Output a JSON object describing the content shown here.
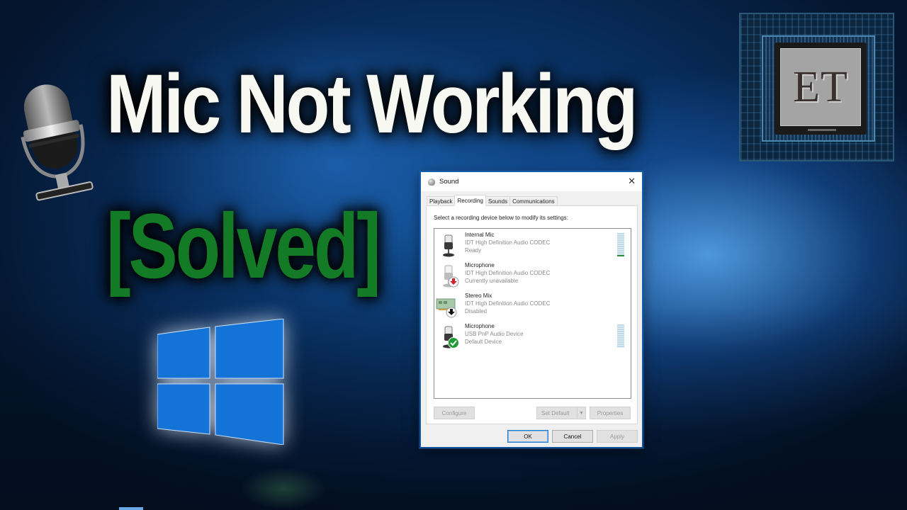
{
  "thumbnail": {
    "headline": "Mic Not Working",
    "subheadline": "[Solved]",
    "headline_color": "#f7f8f2",
    "subheadline_color": "#137a26",
    "logo_text": "ET",
    "illustrations": [
      "microphone-icon",
      "windows-logo-icon",
      "et-chip-logo"
    ]
  },
  "dialog": {
    "title": "Sound",
    "close_icon": "close-icon",
    "tabs": [
      {
        "label": "Playback",
        "active": false
      },
      {
        "label": "Recording",
        "active": true
      },
      {
        "label": "Sounds",
        "active": false
      },
      {
        "label": "Communications",
        "active": false
      }
    ],
    "instruction": "Select a recording device below to modify its settings:",
    "devices": [
      {
        "name": "Internal Mic",
        "driver": "IDT High Definition Audio CODEC",
        "status": "Ready",
        "icon": "microphone-icon",
        "badge": "none",
        "meter_level_pct": 6,
        "show_meter": true
      },
      {
        "name": "Microphone",
        "driver": "IDT High Definition Audio CODEC",
        "status": "Currently unavailable",
        "icon": "microphone-icon",
        "badge": "unplugged-red-arrow-icon",
        "show_meter": false
      },
      {
        "name": "Stereo Mix",
        "driver": "IDT High Definition Audio CODEC",
        "status": "Disabled",
        "icon": "sound-card-icon",
        "badge": "disabled-black-arrow-icon",
        "show_meter": false
      },
      {
        "name": "Microphone",
        "driver": "USB PnP Audio Device",
        "status": "Default Device",
        "icon": "microphone-icon",
        "badge": "default-green-check-icon",
        "meter_level_pct": 0,
        "show_meter": true
      }
    ],
    "buttons": {
      "configure": "Configure",
      "set_default": "Set Default",
      "properties": "Properties",
      "ok": "OK",
      "cancel": "Cancel",
      "apply": "Apply"
    },
    "accent": "#2a78c8"
  }
}
